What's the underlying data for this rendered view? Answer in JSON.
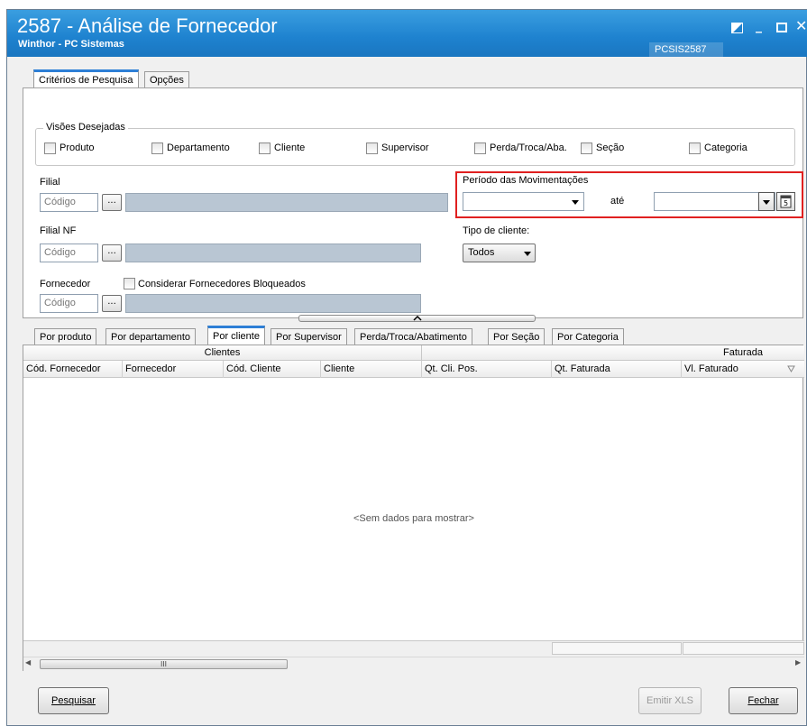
{
  "window": {
    "title": "2587 - Análise de Fornecedor",
    "subtitle": "Winthor - PC Sistemas",
    "routine_code": "PCSIS2587"
  },
  "top_tabs": [
    "Critérios de Pesquisa",
    "Opções"
  ],
  "visoes": {
    "legend": "Visões Desejadas",
    "options": [
      "Produto",
      "Departamento",
      "Cliente",
      "Supervisor",
      "Perda/Troca/Aba.",
      "Seção",
      "Categoria"
    ]
  },
  "filial": {
    "label": "Filial",
    "placeholder": "Código",
    "button": "..."
  },
  "filial_nf": {
    "label": "Filial NF",
    "placeholder": "Código",
    "button": "..."
  },
  "fornecedor": {
    "label": "Fornecedor",
    "checkbox_label": "Considerar Fornecedores Bloqueados",
    "placeholder": "Código",
    "button": "..."
  },
  "periodo": {
    "label": "Período das Movimentações",
    "separator": "até"
  },
  "tipo_cliente": {
    "label": "Tipo de cliente:",
    "value": "Todos"
  },
  "result_tabs": [
    "Por produto",
    "Por departamento",
    "Por cliente",
    "Por Supervisor",
    "Perda/Troca/Abatimento",
    "Por Seção",
    "Por Categoria"
  ],
  "grid": {
    "band_clientes": "Clientes",
    "band_faturada": "Faturada",
    "columns": [
      "Cód. Fornecedor",
      "Fornecedor",
      "Cód. Cliente",
      "Cliente",
      "Qt. Cli. Pos.",
      "Qt. Faturada",
      "Vl. Faturado"
    ],
    "empty_text": "<Sem dados para mostrar>",
    "scroll_grip": "III"
  },
  "buttons": {
    "pesquisar": "Pesquisar",
    "emitir_xls": "Emitir XLS",
    "fechar": "Fechar"
  },
  "colors": {
    "title_bar": "#1e82cf",
    "highlight_border": "#e02020",
    "active_tab": "#2d7fd6"
  }
}
